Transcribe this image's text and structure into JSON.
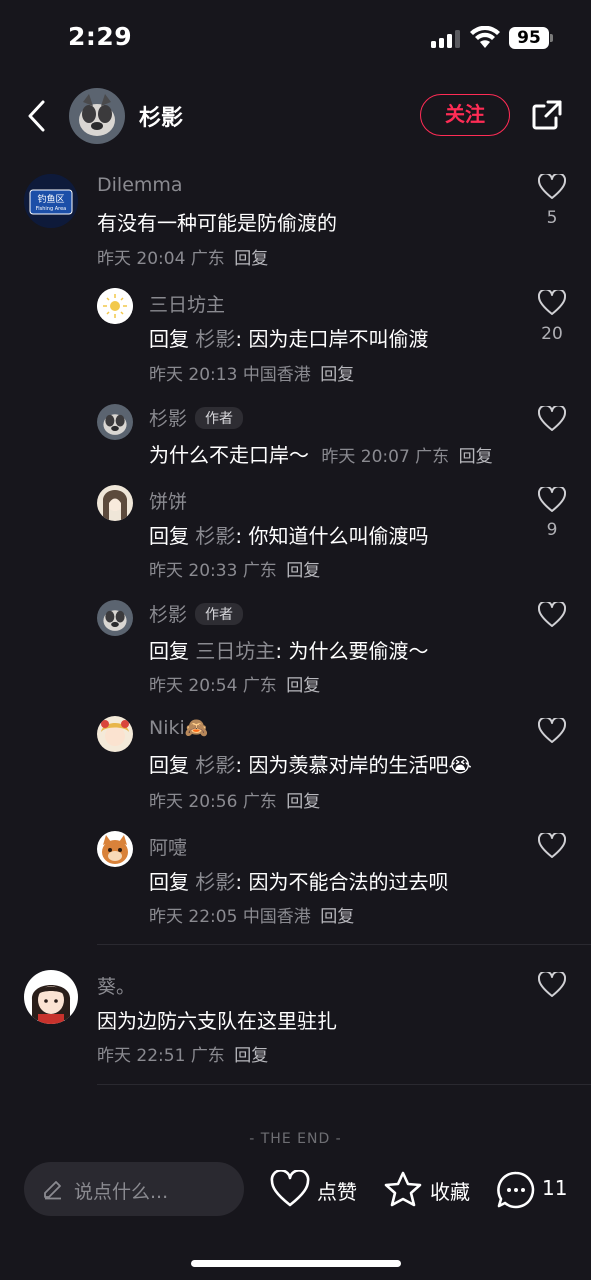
{
  "status_bar": {
    "time": "2:29",
    "battery": "95"
  },
  "header": {
    "name": "杉影",
    "follow_label": "关注"
  },
  "comments": [
    {
      "name": "Dilemma",
      "text": "有没有一种可能是防偷渡的",
      "time": "昨天 20:04",
      "location": "广东",
      "reply_label": "回复",
      "likes": "5"
    },
    {
      "name": "三日坊主",
      "reply_prefix": "回复",
      "reply_to": "杉影",
      "text": ": 因为走口岸不叫偷渡",
      "time": "昨天 20:13",
      "location": "中国香港",
      "reply_label": "回复",
      "likes": "20"
    },
    {
      "name": "杉影",
      "author_tag": "作者",
      "text": "为什么不走口岸～",
      "time": "昨天 20:07",
      "location": "广东",
      "reply_label": "回复"
    },
    {
      "name": "饼饼",
      "reply_prefix": "回复",
      "reply_to": "杉影",
      "text": ": 你知道什么叫偷渡吗",
      "time": "昨天 20:33",
      "location": "广东",
      "reply_label": "回复",
      "likes": "9"
    },
    {
      "name": "杉影",
      "author_tag": "作者",
      "reply_prefix": "回复",
      "reply_to": "三日坊主",
      "text": ": 为什么要偷渡～",
      "time": "昨天 20:54",
      "location": "广东",
      "reply_label": "回复"
    },
    {
      "name": "Niki🙈",
      "reply_prefix": "回复",
      "reply_to": "杉影",
      "text": ": 因为羡慕对岸的生活吧😭",
      "time": "昨天 20:56",
      "location": "广东",
      "reply_label": "回复"
    },
    {
      "name": "阿嚏",
      "reply_prefix": "回复",
      "reply_to": "杉影",
      "text": ": 因为不能合法的过去呗",
      "time": "昨天 22:05",
      "location": "中国香港",
      "reply_label": "回复"
    },
    {
      "name": "葵。",
      "text": "因为边防六支队在这里驻扎",
      "time": "昨天 22:51",
      "location": "广东",
      "reply_label": "回复"
    }
  ],
  "avatar_badge": {
    "line1": "钓鱼区",
    "line2": "Fishing Area"
  },
  "end_label": "- THE END -",
  "bottom_bar": {
    "input_placeholder": "说点什么...",
    "like_label": "点赞",
    "favorite_label": "收藏",
    "comment_count": "11"
  },
  "colors": {
    "background": "#17161c",
    "accent": "#fe2c55",
    "secondary_text": "#8a8a90"
  }
}
